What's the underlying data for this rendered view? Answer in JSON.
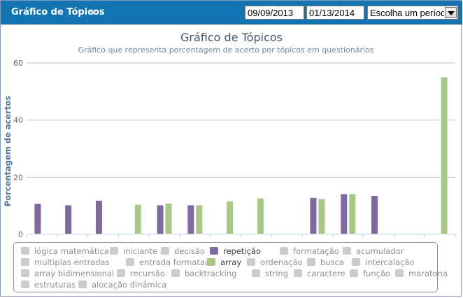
{
  "header": {
    "title": "Gráfico de Tópicos",
    "start_date": "09/09/2013",
    "end_date": "01/13/2014",
    "period_select": "Escolha um período"
  },
  "chart_data": {
    "type": "bar",
    "title": "Gráfico de Tópicos",
    "subtitle": "Gráfico que representa porcentagem de acerto por tópicos em questionários",
    "ylabel": "Porcentagem de acertos",
    "xlabel": "",
    "ylim": [
      0,
      60
    ],
    "yticks": [
      0,
      20,
      40,
      60
    ],
    "grid": true,
    "legend_placement": "bottom",
    "num_groups": 14,
    "colors": {
      "repeticao": "#7f6a9f",
      "array": "#a9c888",
      "inactive": "#cccccc"
    },
    "series": [
      {
        "name": "repetição",
        "values": [
          10.8,
          10.3,
          11.9,
          null,
          10.3,
          10.3,
          null,
          null,
          null,
          12.9,
          14.2,
          13.6,
          null,
          null
        ]
      },
      {
        "name": "array",
        "values": [
          null,
          null,
          null,
          10.5,
          10.9,
          10.3,
          11.7,
          12.7,
          null,
          12.5,
          14.2,
          null,
          null,
          55.1
        ]
      }
    ],
    "legend": [
      {
        "label": "lógica matemática",
        "active": false
      },
      {
        "label": "iniciante",
        "active": false
      },
      {
        "label": "decisão",
        "active": false
      },
      {
        "label": "repetição",
        "active": true,
        "color": "#7f6a9f"
      },
      {
        "label": "formatação",
        "active": false
      },
      {
        "label": "acumulador",
        "active": false
      },
      {
        "label": "multiplas entradas",
        "active": false
      },
      {
        "label": "entrada formatada",
        "active": false
      },
      {
        "label": "array",
        "active": true,
        "color": "#a9c888"
      },
      {
        "label": "ordenação",
        "active": false
      },
      {
        "label": "busca",
        "active": false
      },
      {
        "label": "intercalação",
        "active": false
      },
      {
        "label": "array bidimensional",
        "active": false
      },
      {
        "label": "recursão",
        "active": false
      },
      {
        "label": "backtracking",
        "active": false
      },
      {
        "label": "string",
        "active": false
      },
      {
        "label": "caractere",
        "active": false
      },
      {
        "label": "função",
        "active": false
      },
      {
        "label": "maratona",
        "active": false
      },
      {
        "label": "estruturas",
        "active": false
      },
      {
        "label": "alocação dinâmica",
        "active": false
      }
    ]
  }
}
